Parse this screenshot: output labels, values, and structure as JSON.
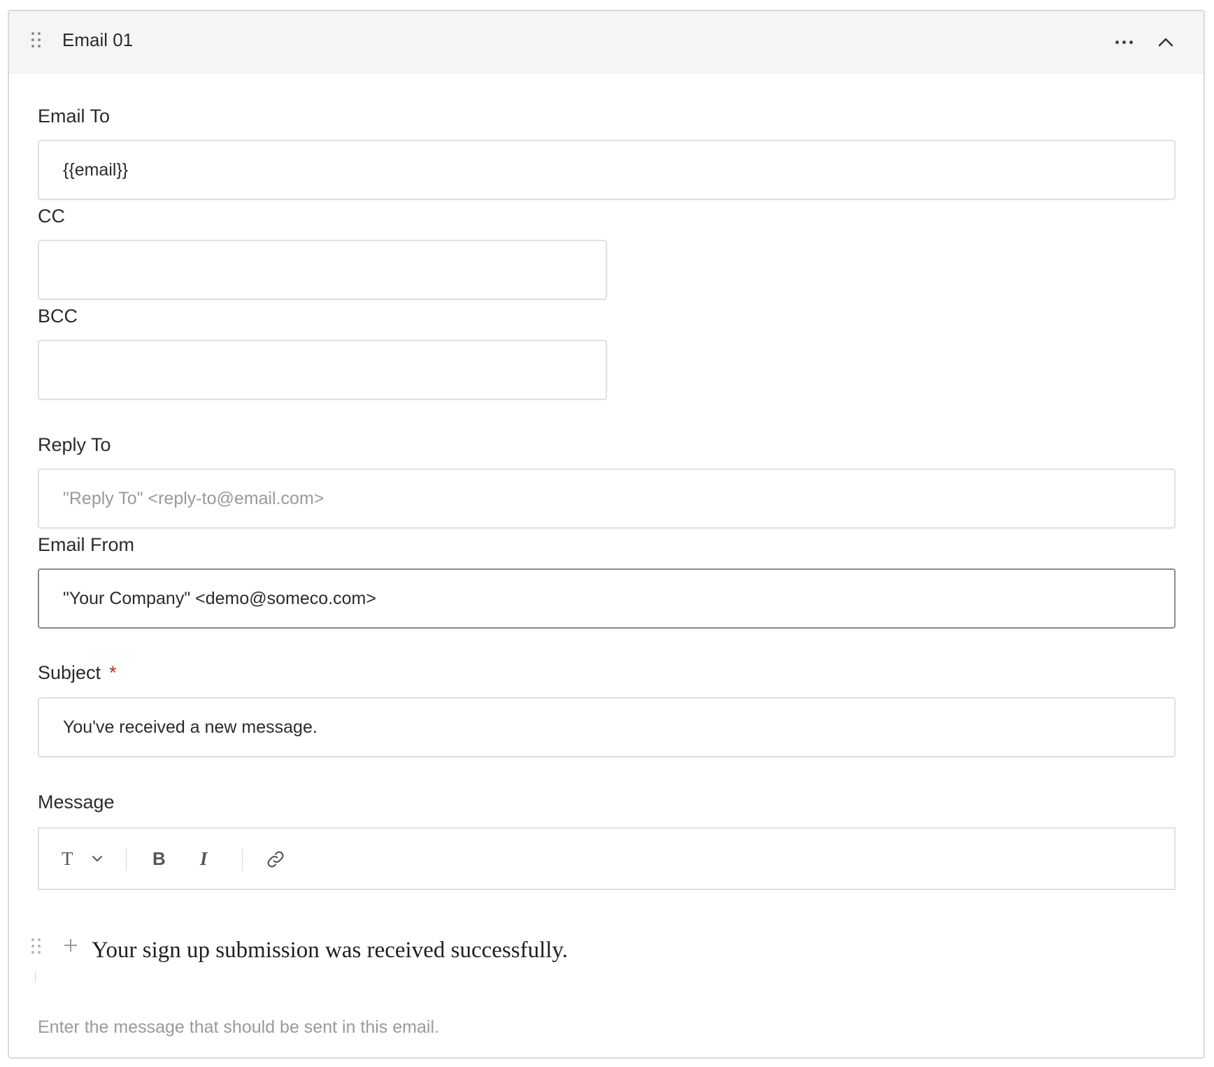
{
  "header": {
    "title": "Email 01",
    "icons": [
      "drag-handle-icon",
      "more-horizontal-icon",
      "chevron-up-icon"
    ]
  },
  "fields": {
    "email_to": {
      "label": "Email To",
      "value": "{{email}}"
    },
    "cc": {
      "label": "CC",
      "value": ""
    },
    "bcc": {
      "label": "BCC",
      "value": ""
    },
    "reply_to": {
      "label": "Reply To",
      "value": "",
      "placeholder": "\"Reply To\" <reply-to@email.com>"
    },
    "email_from": {
      "label": "Email From",
      "value": "\"Your Company\" <demo@someco.com>"
    },
    "subject": {
      "label": "Subject",
      "required_mark": "*",
      "value": "You've received a new message."
    },
    "message": {
      "label": "Message",
      "toolbar": {
        "text_style_glyph": "T",
        "icons": [
          "text-style-icon",
          "chevron-down-icon",
          "bold-icon",
          "italic-icon",
          "link-icon"
        ]
      },
      "content": "Your sign up submission was received successfully.",
      "help_text": "Enter the message that should be sent in this email."
    }
  },
  "colors": {
    "header_bg": "#f5f5f5",
    "border": "#e0e0e0",
    "focused_border": "#8a8a8a",
    "required": "#c62828",
    "placeholder": "#9a9a9a"
  }
}
